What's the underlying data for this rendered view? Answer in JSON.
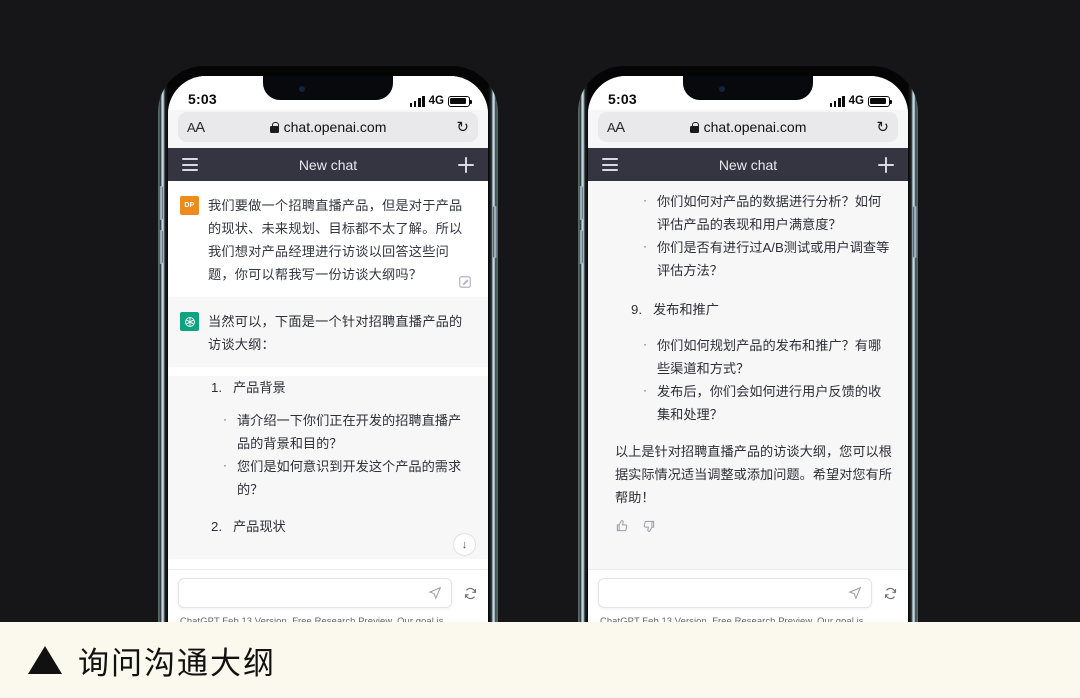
{
  "caption": {
    "marker": "▲",
    "text": "询问沟通大纲"
  },
  "statusbar": {
    "time": "5:03",
    "network": "4G"
  },
  "browser": {
    "aa_small": "A",
    "aa_large": "A",
    "url": "chat.openai.com",
    "reload_icon": "↻"
  },
  "chat_header": {
    "title": "New chat"
  },
  "composer": {
    "placeholder": "",
    "value": "",
    "footer_link": "ChatGPT Feb 13 Version",
    "footer_rest": ". Free Research Preview. Our goal is"
  },
  "phone1": {
    "user_message": {
      "avatar_label": "DP",
      "text": "我们要做一个招聘直播产品，但是对于产品的现状、未来规划、目标都不太了解。所以我们想对产品经理进行访谈以回答这些问题，你可以帮我写一份访谈大纲吗？"
    },
    "bot_intro": "当然可以，下面是一个针对招聘直播产品的访谈大纲：",
    "section1": {
      "num": "1.",
      "title": "产品背景"
    },
    "bullets1": [
      "请介绍一下你们正在开发的招聘直播产品的背景和目的？",
      "您们是如何意识到开发这个产品的需求的？"
    ],
    "section2": {
      "num": "2.",
      "title": "产品现状"
    }
  },
  "phone2": {
    "bullets_top": [
      "你们如何对产品的数据进行分析？如何评估产品的表现和用户满意度？",
      "你们是否有进行过A/B测试或用户调查等评估方法？"
    ],
    "section9": {
      "num": "9.",
      "title": "发布和推广"
    },
    "bullets9": [
      "你们如何规划产品的发布和推广？有哪些渠道和方式？",
      "发布后，你们会如何进行用户反馈的收集和处理？"
    ],
    "closing": "以上是针对招聘直播产品的访谈大纲，您可以根据实际情况适当调整或添加问题。希望对您有所帮助！"
  },
  "colors": {
    "canvas": "#161618",
    "caption_bg": "#fbf8ed",
    "header": "#343541",
    "accent_green": "#10a37f",
    "accent_orange": "#ec8c1c",
    "bot_bg": "#f7f7f8"
  }
}
